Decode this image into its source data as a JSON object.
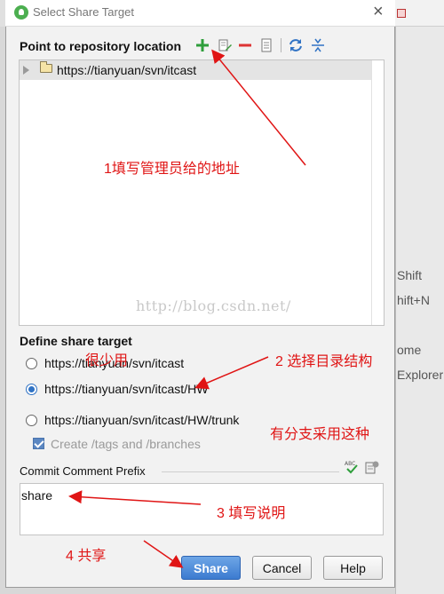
{
  "dialog": {
    "title": "Select Share Target",
    "close_label": "×"
  },
  "repository": {
    "section_label": "Point to repository location",
    "toolbar_icons": [
      "add-icon",
      "edit-icon",
      "remove-icon",
      "info-icon",
      "refresh-icon",
      "collapse-icon"
    ],
    "items": [
      {
        "url": "https://tianyuan/svn/itcast",
        "expanded": false,
        "selected": true
      }
    ]
  },
  "share_target": {
    "section_label": "Define share target",
    "options": [
      {
        "label": "https://tianyuan/svn/itcast",
        "selected": false
      },
      {
        "label": "https://tianyuan/svn/itcast/HW",
        "selected": true
      },
      {
        "label": "https://tianyuan/svn/itcast/HW/trunk",
        "selected": false
      }
    ],
    "create_tags_label": "Create /tags and /branches",
    "create_tags_checked": true,
    "create_tags_enabled": false
  },
  "commit": {
    "label": "Commit Comment Prefix",
    "value": "share",
    "icons": [
      "spellcheck-icon",
      "history-icon"
    ]
  },
  "buttons": {
    "share": "Share",
    "cancel": "Cancel",
    "help": "Help"
  },
  "annotations": {
    "step1": "1填写管理员给的地址",
    "step2": "2 选择目录结构",
    "step3": "3 填写说明",
    "step4": "4 共享",
    "note_rare": "很少用",
    "note_branch": "有分支采用这种"
  },
  "watermark": "http://blog.csdn.net/",
  "background_window": {
    "items": [
      "Shift",
      "hift+N",
      "ome",
      "Explorer"
    ]
  },
  "colors": {
    "annotation": "#e01515",
    "accent": "#3c7bd0",
    "selected_row": "#e4e4e4"
  }
}
